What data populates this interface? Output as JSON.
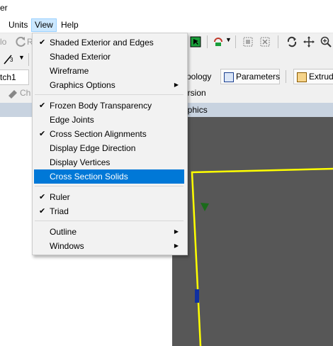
{
  "title": "er",
  "menubar": {
    "units": "Units",
    "view": "View",
    "help": "Help"
  },
  "toolbar": {
    "partial_lo": "lo",
    "partial_re": "R",
    "sketch_field": "tch1",
    "topology": "pology",
    "parameters": "Parameters",
    "extrude": "Extrud",
    "ch": "Ch",
    "version": "ersion",
    "graphics": "aphics",
    "dim_label": "3"
  },
  "view_menu": {
    "items": [
      {
        "label": "Shaded Exterior and Edges",
        "checked": true,
        "submenu": false
      },
      {
        "label": "Shaded Exterior",
        "checked": false,
        "submenu": false
      },
      {
        "label": "Wireframe",
        "checked": false,
        "submenu": false
      },
      {
        "label": "Graphics Options",
        "checked": false,
        "submenu": true
      },
      {
        "label": "Frozen Body Transparency",
        "checked": true,
        "submenu": false
      },
      {
        "label": "Edge Joints",
        "checked": false,
        "submenu": false
      },
      {
        "label": "Cross Section Alignments",
        "checked": true,
        "submenu": false
      },
      {
        "label": "Display Edge Direction",
        "checked": false,
        "submenu": false
      },
      {
        "label": "Display Vertices",
        "checked": false,
        "submenu": false
      },
      {
        "label": "Cross Section Solids",
        "checked": false,
        "submenu": false,
        "highlighted": true
      },
      {
        "label": "Ruler",
        "checked": true,
        "submenu": false
      },
      {
        "label": "Triad",
        "checked": true,
        "submenu": false
      },
      {
        "label": "Outline",
        "checked": false,
        "submenu": true
      },
      {
        "label": "Windows",
        "checked": false,
        "submenu": true
      }
    ],
    "check_glyph": "✔",
    "arrow_glyph": "▶"
  },
  "colors": {
    "highlight": "#0078d7",
    "viewport": "#575757",
    "yellow_line": "#ffff00"
  }
}
